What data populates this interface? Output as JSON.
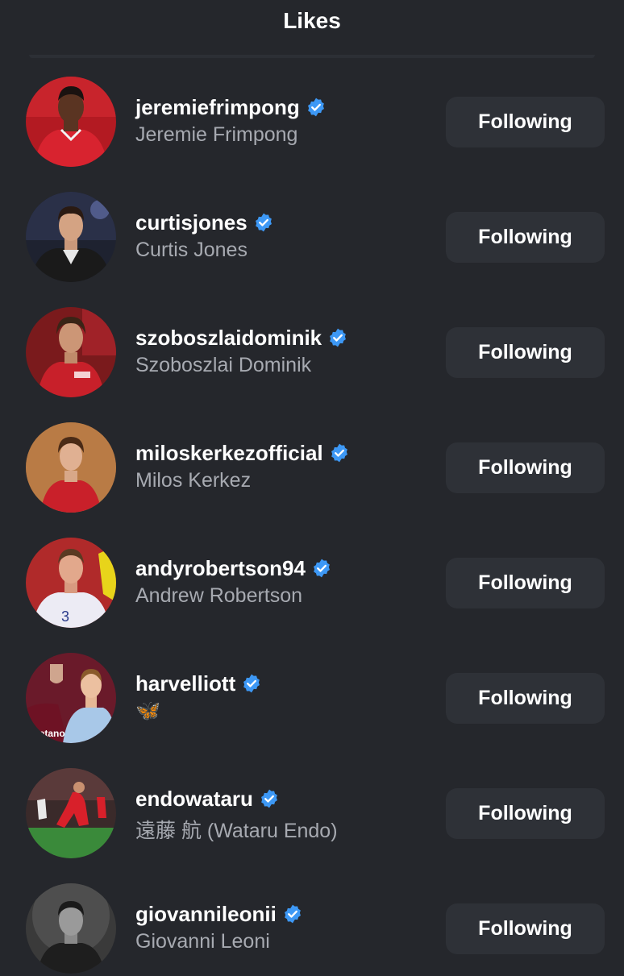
{
  "header": {
    "title": "Likes"
  },
  "accent": {
    "verified_color": "#3d98f5",
    "background": "#25272c",
    "button_bg": "#2e3137"
  },
  "users": [
    {
      "username": "jeremiefrimpong",
      "fullname": "Jeremie Frimpong",
      "verified": true,
      "button_label": "Following",
      "avatar_icon": "avatar-photo"
    },
    {
      "username": "curtisjones",
      "fullname": "Curtis Jones",
      "verified": true,
      "button_label": "Following",
      "avatar_icon": "avatar-photo"
    },
    {
      "username": "szoboszlaidominik",
      "fullname": "Szoboszlai Dominik",
      "verified": true,
      "button_label": "Following",
      "avatar_icon": "avatar-photo"
    },
    {
      "username": "miloskerkezofficial",
      "fullname": "Milos Kerkez",
      "verified": true,
      "button_label": "Following",
      "avatar_icon": "avatar-photo"
    },
    {
      "username": "andyrobertson94",
      "fullname": "Andrew Robertson",
      "verified": true,
      "button_label": "Following",
      "avatar_icon": "avatar-photo"
    },
    {
      "username": "harvelliott",
      "fullname": "🦋",
      "verified": true,
      "button_label": "Following",
      "avatar_icon": "avatar-photo"
    },
    {
      "username": "endowataru",
      "fullname": "遠藤 航 (Wataru Endo)",
      "verified": true,
      "button_label": "Following",
      "avatar_icon": "avatar-photo"
    },
    {
      "username": "giovannileonii",
      "fullname": "Giovanni Leoni",
      "verified": true,
      "button_label": "Following",
      "avatar_icon": "avatar-photo"
    }
  ]
}
